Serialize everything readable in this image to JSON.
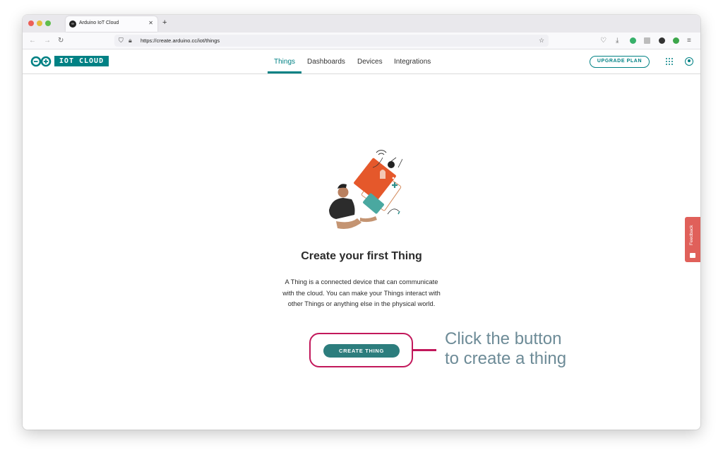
{
  "browser": {
    "tab_title": "Arduino IoT Cloud",
    "tab_favicon_text": "∞",
    "new_tab_label": "+",
    "url": "https://create.arduino.cc/iot/things"
  },
  "header": {
    "logo_text": "IOT CLOUD",
    "nav": [
      {
        "label": "Things",
        "active": true
      },
      {
        "label": "Dashboards",
        "active": false
      },
      {
        "label": "Devices",
        "active": false
      },
      {
        "label": "Integrations",
        "active": false
      }
    ],
    "upgrade_label": "UPGRADE PLAN"
  },
  "main": {
    "heading": "Create your first Thing",
    "description": "A Thing is a connected device that can communicate with the cloud. You can make your Things interact with other Things or anything else in the physical world.",
    "create_button": "CREATE THING"
  },
  "annotation": {
    "line1": "Click the button",
    "line2": "to create a thing"
  },
  "feedback_label": "Feedback",
  "colors": {
    "brand": "#008184",
    "button": "#2c7d7d",
    "highlight": "#c2185b",
    "callout_text": "#6d8b97",
    "feedback": "#e0605a"
  },
  "icons": [
    "back-icon",
    "forward-icon",
    "reload-icon",
    "shield-icon",
    "lock-icon",
    "bookmark-star-icon",
    "pocket-icon",
    "download-icon",
    "grid-apps-icon",
    "account-icon"
  ]
}
